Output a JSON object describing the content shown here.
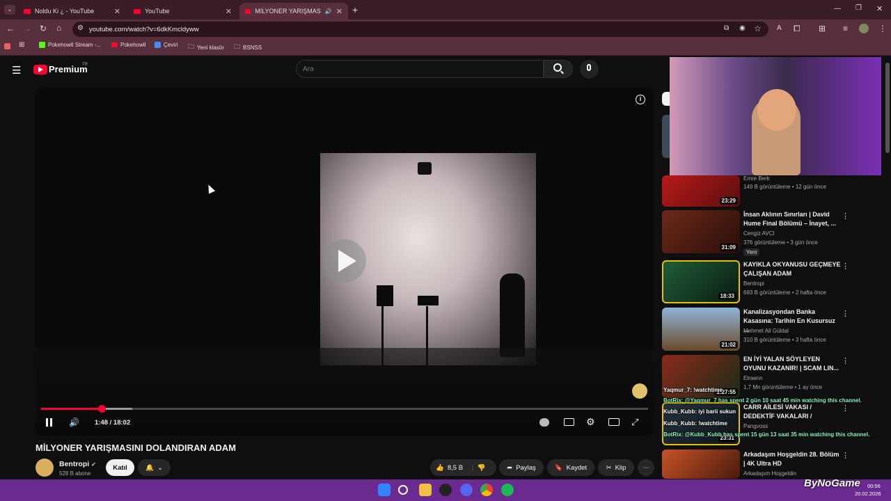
{
  "tabs": [
    {
      "label": "Noldu Ki ¿ - YouTube"
    },
    {
      "label": "YouTube"
    },
    {
      "label": "MİLYONER YARIŞMASINI D"
    }
  ],
  "address": "youtube.com/watch?v=6dkKmcldyww",
  "bookmarks": [
    "Pokehowll Stream -...",
    "Pokehowll",
    "Çeviri",
    "Yeni klasör",
    "BSNSS"
  ],
  "header": {
    "logo": "Premium",
    "region": "TR",
    "search_placeholder": "Ara"
  },
  "player": {
    "time": "1:48 / 18:02",
    "played_fraction": 0.1,
    "buffered_fraction": 0.15
  },
  "video": {
    "title": "MİLYONER YARIŞMASINI DOLANDIRAN ADAM",
    "channel": "Bentropi",
    "subscribers": "528 B abone",
    "join_label": "Katıl",
    "likes": "8,5 B",
    "share": "Paylaş",
    "save": "Kaydet",
    "clip": "Klip"
  },
  "recommendations": [
    {
      "title": "",
      "channel": "Emre Berk",
      "meta": "149 B görüntüleme • 12 gün önce",
      "duration": "23:29"
    },
    {
      "title": "İnsan Aklının Sınırları | David Hume Final Bölümü – İnayet, ...",
      "channel": "Cengiz AVCI",
      "meta": "376 görüntüleme • 3 gün önce",
      "duration": "31:09",
      "badge": "Yeni"
    },
    {
      "title": "KAYIKLA OKYANUSU GEÇMEYE ÇALIŞAN ADAM",
      "channel": "Bentropi",
      "meta": "693 B görüntüleme • 2 hafta önce",
      "duration": "18:33"
    },
    {
      "title": "Kanalizasyondan Banka Kasasına: Tarihin En Kusursuz ...",
      "channel": "Mehmet Ali Güldal",
      "meta": "310 B görüntüleme • 3 hafta önce",
      "duration": "21:02"
    },
    {
      "title": "EN İYİ YALAN SÖYLEYEN OYUNU KAZANIR! | SCAM LIN...",
      "channel": "Elraenn",
      "meta": "1,7 Mn görüntüleme • 1 ay önce",
      "duration": "1:27:55"
    },
    {
      "title": "CARR AİLESİ VAKASI / DEDEKTİF VAKALARI /",
      "channel": "Pangvoss",
      "meta": "",
      "duration": "23:31"
    },
    {
      "title": "Arkadaşım Hoşgeldin 28. Bölüm | 4K Ultra HD",
      "channel": "Arkadaşım Hoşgeldin",
      "meta": "",
      "duration": ""
    }
  ],
  "chat": [
    "Yaqmur_7: !watchtime",
    "BotRix: @Yaqmur_7 has spent 2 gün 10 saat 45 min watching this channel.",
    "Kubb_Kubb: iyi barii sukun",
    "Kubb_Kubb: !watchtime",
    "BotRix: @Kubb_Kubb has spent 15 gün 13 saat 35 min watching this channel."
  ],
  "clock": {
    "time": "00:56",
    "date": "20.02.2026"
  },
  "watermark": "ByNoGame"
}
